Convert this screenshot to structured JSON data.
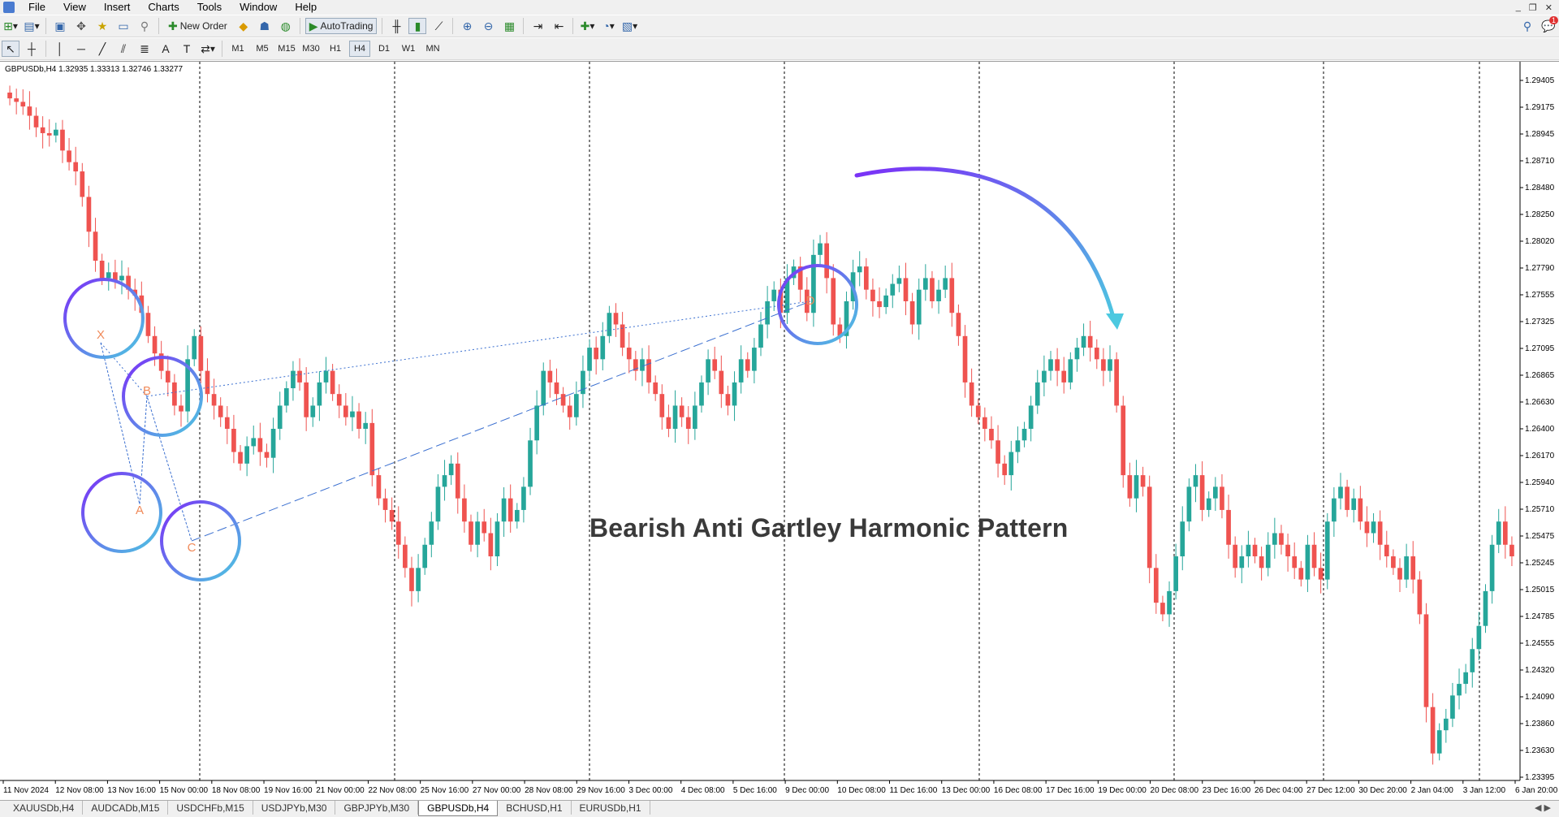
{
  "menu": [
    "File",
    "View",
    "Insert",
    "Charts",
    "Tools",
    "Window",
    "Help"
  ],
  "toolbar": {
    "new_order": "New Order",
    "autotrading": "AutoTrading",
    "timeframes": [
      "M1",
      "M5",
      "M15",
      "M30",
      "H1",
      "H4",
      "D1",
      "W1",
      "MN"
    ],
    "active_timeframe": "H4",
    "notification_count": "1"
  },
  "chart": {
    "header": "GBPUSDb,H4  1.32935 1.33313 1.32746 1.33277",
    "title": "Bearish Anti Gartley Harmonic Pattern",
    "bull_color": "#26a69a",
    "bear_color": "#ef5350",
    "circle_colors": [
      "#7b2ff7",
      "#4cc9e0"
    ],
    "pattern_labels": [
      "X",
      "A",
      "B",
      "C",
      "D"
    ],
    "price_axis": [
      "1.29405",
      "1.29175",
      "1.28945",
      "1.28710",
      "1.28480",
      "1.28250",
      "1.28020",
      "1.27790",
      "1.27555",
      "1.27325",
      "1.27095",
      "1.26865",
      "1.26630",
      "1.26400",
      "1.26170",
      "1.25940",
      "1.25710",
      "1.25475",
      "1.25245",
      "1.25015",
      "1.24785",
      "1.24555",
      "1.24320",
      "1.24090",
      "1.23860",
      "1.23630",
      "1.23395"
    ],
    "time_axis": [
      "11 Nov 2024",
      "12 Nov 08:00",
      "13 Nov 16:00",
      "15 Nov 00:00",
      "18 Nov 08:00",
      "19 Nov 16:00",
      "21 Nov 00:00",
      "22 Nov 08:00",
      "25 Nov 16:00",
      "27 Nov 00:00",
      "28 Nov 08:00",
      "29 Nov 16:00",
      "3 Dec 00:00",
      "4 Dec 08:00",
      "5 Dec 16:00",
      "9 Dec 00:00",
      "10 Dec 08:00",
      "11 Dec 16:00",
      "13 Dec 00:00",
      "16 Dec 08:00",
      "17 Dec 16:00",
      "19 Dec 00:00",
      "20 Dec 08:00",
      "23 Dec 16:00",
      "26 Dec 04:00",
      "27 Dec 12:00",
      "30 Dec 20:00",
      "2 Jan 04:00",
      "3 Jan 12:00",
      "6 Jan 20:00"
    ],
    "ohlc_close_series": [
      1.2925,
      1.2922,
      1.2918,
      1.291,
      1.29,
      1.2895,
      1.2893,
      1.2898,
      1.288,
      1.287,
      1.2862,
      1.284,
      1.281,
      1.2785,
      1.277,
      1.2775,
      1.2768,
      1.2772,
      1.276,
      1.2755,
      1.274,
      1.272,
      1.2705,
      1.269,
      1.268,
      1.266,
      1.2655,
      1.27,
      1.272,
      1.269,
      1.267,
      1.266,
      1.265,
      1.264,
      1.262,
      1.261,
      1.2625,
      1.2632,
      1.262,
      1.2615,
      1.264,
      1.266,
      1.2675,
      1.269,
      1.268,
      1.265,
      1.266,
      1.268,
      1.269,
      1.267,
      1.266,
      1.265,
      1.2655,
      1.264,
      1.2645,
      1.26,
      1.258,
      1.257,
      1.256,
      1.254,
      1.252,
      1.25,
      1.252,
      1.254,
      1.256,
      1.259,
      1.26,
      1.261,
      1.258,
      1.256,
      1.254,
      1.256,
      1.255,
      1.253,
      1.256,
      1.258,
      1.256,
      1.257,
      1.259,
      1.263,
      1.266,
      1.269,
      1.268,
      1.267,
      1.266,
      1.265,
      1.267,
      1.269,
      1.271,
      1.27,
      1.272,
      1.274,
      1.273,
      1.271,
      1.27,
      1.269,
      1.27,
      1.268,
      1.267,
      1.265,
      1.264,
      1.266,
      1.265,
      1.264,
      1.266,
      1.268,
      1.27,
      1.269,
      1.267,
      1.266,
      1.268,
      1.27,
      1.269,
      1.271,
      1.273,
      1.275,
      1.276,
      1.274,
      1.277,
      1.278,
      1.276,
      1.274,
      1.279,
      1.28,
      1.277,
      1.273,
      1.272,
      1.275,
      1.2775,
      1.278,
      1.276,
      1.275,
      1.2745,
      1.2755,
      1.2765,
      1.277,
      1.275,
      1.273,
      1.276,
      1.277,
      1.275,
      1.276,
      1.277,
      1.274,
      1.272,
      1.268,
      1.266,
      1.265,
      1.264,
      1.263,
      1.261,
      1.26,
      1.262,
      1.263,
      1.264,
      1.266,
      1.268,
      1.269,
      1.27,
      1.269,
      1.268,
      1.27,
      1.271,
      1.272,
      1.271,
      1.27,
      1.269,
      1.27,
      1.266,
      1.26,
      1.258,
      1.26,
      1.259,
      1.252,
      1.249,
      1.248,
      1.25,
      1.253,
      1.256,
      1.259,
      1.26,
      1.257,
      1.258,
      1.259,
      1.257,
      1.254,
      1.252,
      1.253,
      1.254,
      1.253,
      1.252,
      1.254,
      1.255,
      1.254,
      1.253,
      1.252,
      1.251,
      1.254,
      1.252,
      1.251,
      1.256,
      1.258,
      1.259,
      1.257,
      1.258,
      1.256,
      1.255,
      1.256,
      1.254,
      1.253,
      1.252,
      1.251,
      1.253,
      1.251,
      1.248,
      1.24,
      1.236,
      1.238,
      1.239,
      1.241,
      1.242,
      1.243,
      1.245,
      1.247,
      1.25,
      1.254,
      1.256,
      1.254,
      1.253
    ]
  },
  "tabs": [
    "XAUUSDb,H4",
    "AUDCADb,M15",
    "USDCHFb,M15",
    "USDJPYb,M30",
    "GBPJPYb,M30",
    "GBPUSDb,H4",
    "BCHUSD,H1",
    "EURUSDb,H1"
  ],
  "active_tab": "GBPUSDb,H4"
}
